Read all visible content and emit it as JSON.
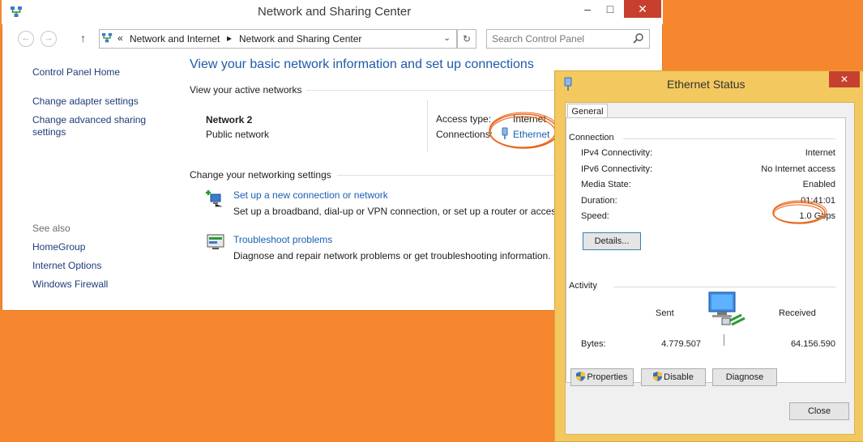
{
  "main_window": {
    "title": "Network and Sharing Center",
    "breadcrumb": {
      "chevron": "«",
      "items": [
        "Network and Internet",
        "Network and Sharing Center"
      ]
    },
    "search_placeholder": "Search Control Panel",
    "left_nav": {
      "items": [
        "Control Panel Home",
        "Change adapter settings",
        "Change advanced sharing\nsettings"
      ],
      "see_also_label": "See also",
      "see_also": [
        "HomeGroup",
        "Internet Options",
        "Windows Firewall"
      ]
    },
    "heading": "View your basic network information and set up connections",
    "active_networks_label": "View your active networks",
    "network": {
      "name": "Network  2",
      "type": "Public network",
      "access_type_label": "Access type:",
      "access_type_value": "Internet",
      "connections_label": "Connections:",
      "connection_link": "Ethernet"
    },
    "change_settings_label": "Change your networking settings",
    "tasks": [
      {
        "title": "Set up a new connection or network",
        "desc": "Set up a broadband, dial-up or VPN connection, or set up a router or access"
      },
      {
        "title": "Troubleshoot problems",
        "desc": "Diagnose and repair network problems or get troubleshooting information."
      }
    ]
  },
  "dialog": {
    "title": "Ethernet Status",
    "tab": "General",
    "connection_label": "Connection",
    "rows": [
      {
        "label": "IPv4 Connectivity:",
        "value": "Internet"
      },
      {
        "label": "IPv6 Connectivity:",
        "value": "No Internet access"
      },
      {
        "label": "Media State:",
        "value": "Enabled"
      },
      {
        "label": "Duration:",
        "value": "01:41:01"
      },
      {
        "label": "Speed:",
        "value": "1.0 Gbps"
      }
    ],
    "details_button": "Details...",
    "activity_label": "Activity",
    "sent_label": "Sent",
    "received_label": "Received",
    "bytes_label": "Bytes:",
    "bytes_sent": "4.779.507",
    "bytes_received": "64.156.590",
    "properties_button": "Properties",
    "disable_button": "Disable",
    "diagnose_button": "Diagnose",
    "close_button": "Close"
  },
  "colors": {
    "desktop": "#f7872e",
    "annotation": "#e8671a",
    "link": "#1a5fb4",
    "dialog_frame": "#f3c95f"
  }
}
